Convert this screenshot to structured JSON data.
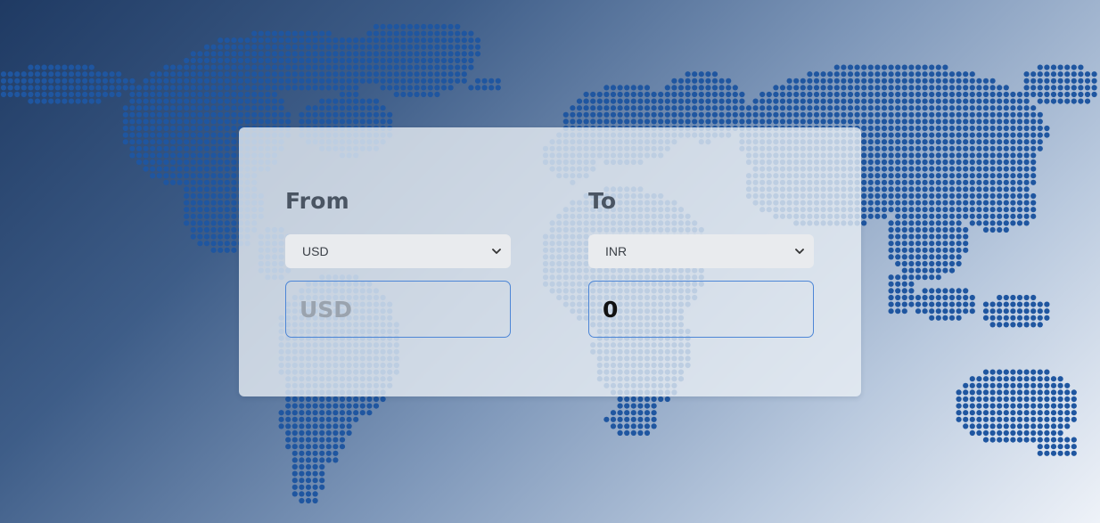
{
  "colors": {
    "map_dot": "#1f56a0",
    "input_border": "#4d86d6",
    "label_text": "#4a5563"
  },
  "converter": {
    "from": {
      "label": "From",
      "selected_currency": "USD",
      "amount_placeholder": "USD",
      "amount_value": ""
    },
    "to": {
      "label": "To",
      "selected_currency": "INR",
      "amount_value": "0"
    }
  },
  "icons": {
    "select_arrow": "chevron-down-icon",
    "background": "world-map-dots"
  }
}
